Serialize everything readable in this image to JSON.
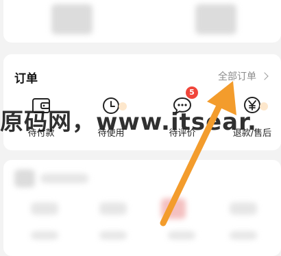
{
  "orders": {
    "title": "订单",
    "all_orders_label": "全部订单",
    "items": [
      {
        "label": "待付款",
        "icon": "wallet-icon"
      },
      {
        "label": "待使用",
        "icon": "clock-icon"
      },
      {
        "label": "待评价",
        "icon": "chat-bubble-icon",
        "badge": "5"
      },
      {
        "label": "退款/售后",
        "icon": "yen-refund-icon"
      }
    ]
  },
  "watermark": "原码网，www.itsear.",
  "colors": {
    "badge": "#f0453a",
    "annotation_arrow": "#f39c2c",
    "background": "#f3f3f3"
  }
}
